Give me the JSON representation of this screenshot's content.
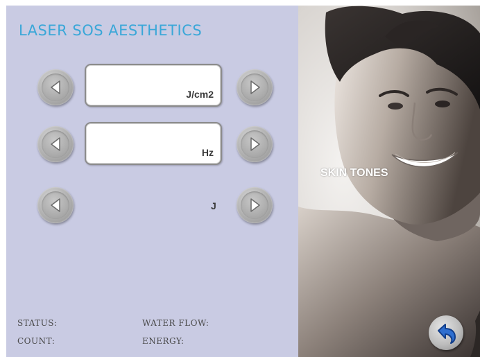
{
  "app": {
    "title": "LASER SOS AESTHETICS"
  },
  "controls": [
    {
      "id": "fluence",
      "unit": "J/cm2",
      "value": "",
      "boxed": true
    },
    {
      "id": "frequency",
      "unit": "Hz",
      "value": "",
      "boxed": true
    },
    {
      "id": "energy",
      "unit": "J",
      "value": "",
      "boxed": false
    }
  ],
  "status": {
    "status_label": "STATUS:",
    "count_label": "COUNT:",
    "water_flow_label": "WATER FLOW:",
    "energy_label": "ENERGY:"
  },
  "right_panel": {
    "skin_tones_label": "SKIN TONES",
    "photo_subject": "portrait of a smiling man"
  },
  "icons": {
    "decrease": "left-arrow-icon",
    "increase": "right-arrow-icon",
    "back": "back-return-icon"
  },
  "colors": {
    "panel_bg": "#c9cbe3",
    "title": "#3aa7d8",
    "back_arrow": "#2f6fd0"
  }
}
